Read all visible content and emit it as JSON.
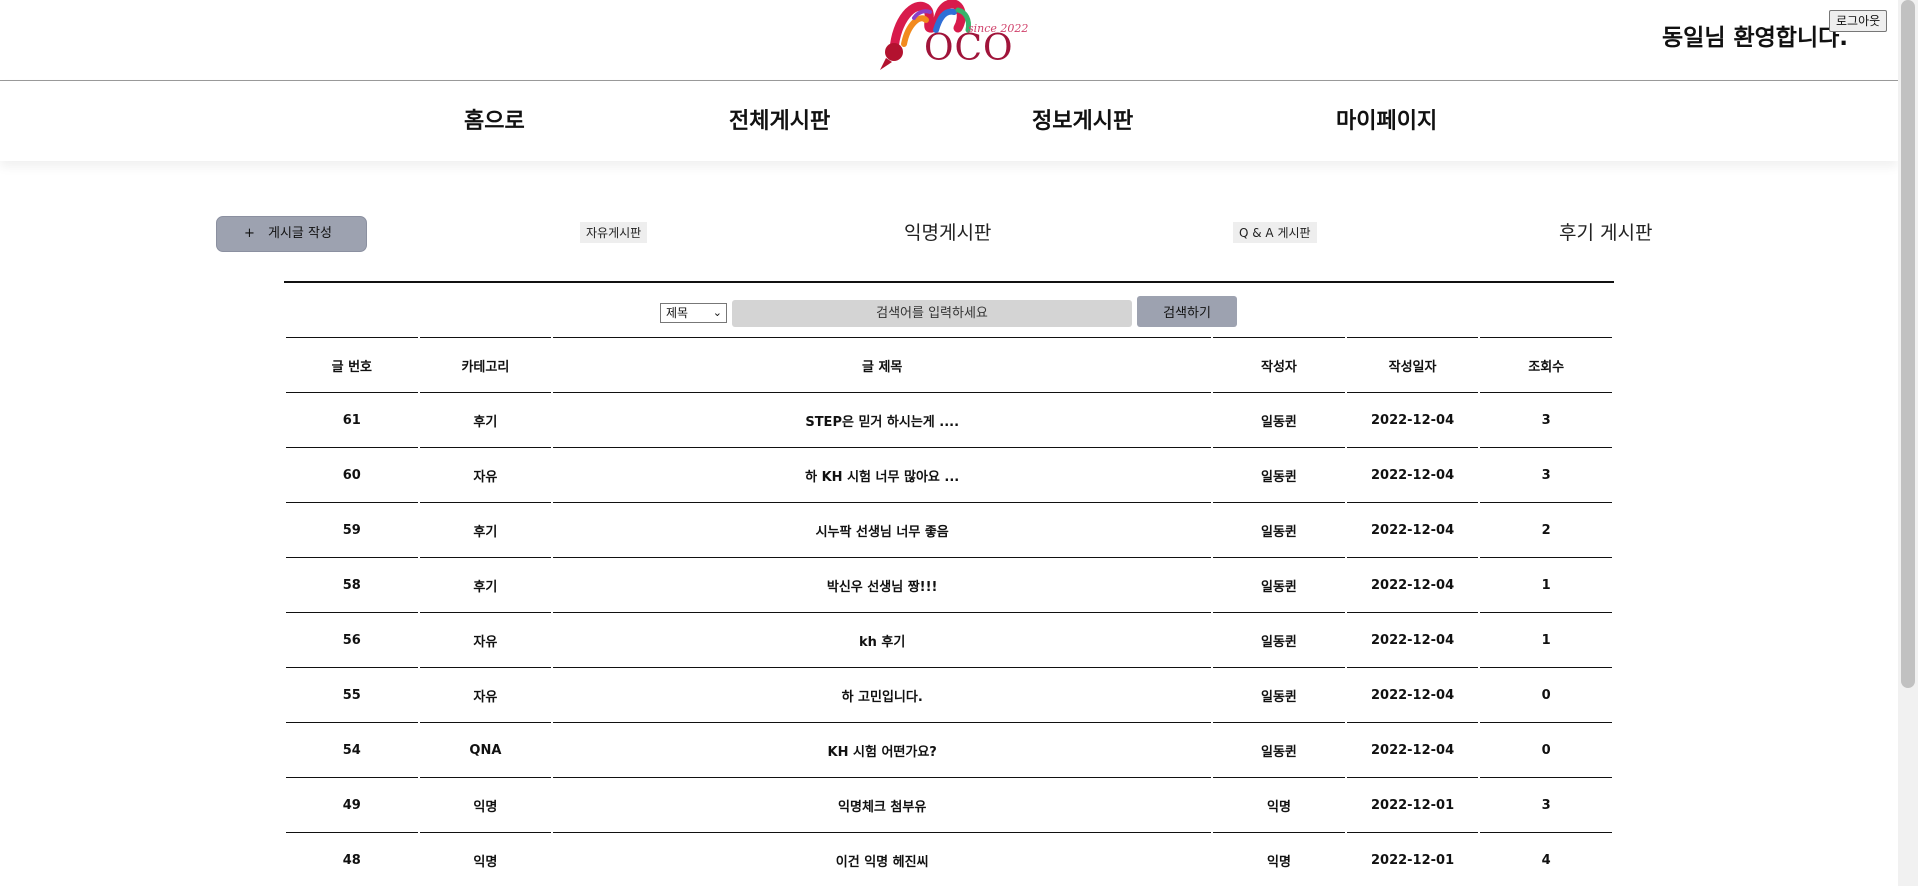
{
  "header": {
    "logo_text": "OCO",
    "logo_since": "since 2022",
    "welcome": "동일님 환영합니다.",
    "logout_label": "로그아웃"
  },
  "nav": {
    "items": [
      {
        "label": "홈으로"
      },
      {
        "label": "전체게시판"
      },
      {
        "label": "정보게시판"
      },
      {
        "label": "마이페이지"
      }
    ]
  },
  "boards": {
    "write_plus": "+",
    "write_label": "게시글 작성",
    "tabs": [
      {
        "label": "자유게시판"
      },
      {
        "label": "익명게시판"
      },
      {
        "label": "Q & A 게시판"
      },
      {
        "label": "후기 게시판"
      }
    ]
  },
  "search": {
    "select_value": "제목",
    "placeholder": "검색어를 입력하세요",
    "button_label": "검색하기"
  },
  "table": {
    "headers": [
      "글 번호",
      "카테고리",
      "글 제목",
      "작성자",
      "작성일자",
      "조회수"
    ],
    "rows": [
      {
        "no": "61",
        "category": "후기",
        "title": "STEP은 믿거 하시는게 ....",
        "author": "일동퀸",
        "date": "2022-12-04",
        "views": "3"
      },
      {
        "no": "60",
        "category": "자유",
        "title": "하 KH 시험 너무 많아요 ...",
        "author": "일동퀸",
        "date": "2022-12-04",
        "views": "3"
      },
      {
        "no": "59",
        "category": "후기",
        "title": "시누팍 선생님 너무 좋음",
        "author": "일동퀸",
        "date": "2022-12-04",
        "views": "2"
      },
      {
        "no": "58",
        "category": "후기",
        "title": "박신우 선생님 짱!!!",
        "author": "일동퀸",
        "date": "2022-12-04",
        "views": "1"
      },
      {
        "no": "56",
        "category": "자유",
        "title": "kh 후기",
        "author": "일동퀸",
        "date": "2022-12-04",
        "views": "1"
      },
      {
        "no": "55",
        "category": "자유",
        "title": "하 고민입니다.",
        "author": "일동퀸",
        "date": "2022-12-04",
        "views": "0"
      },
      {
        "no": "54",
        "category": "QNA",
        "title": "KH 시험 어떤가요?",
        "author": "일동퀸",
        "date": "2022-12-04",
        "views": "0"
      },
      {
        "no": "49",
        "category": "익명",
        "title": "익명체크 첨부유",
        "author": "익명",
        "date": "2022-12-01",
        "views": "3"
      },
      {
        "no": "48",
        "category": "익명",
        "title": "이건 익명 헤진씨",
        "author": "익명",
        "date": "2022-12-01",
        "views": "4"
      }
    ]
  },
  "colors": {
    "brand": "#a0143a",
    "button_gray": "#9da2b0",
    "input_gray": "#d4d4d4"
  }
}
